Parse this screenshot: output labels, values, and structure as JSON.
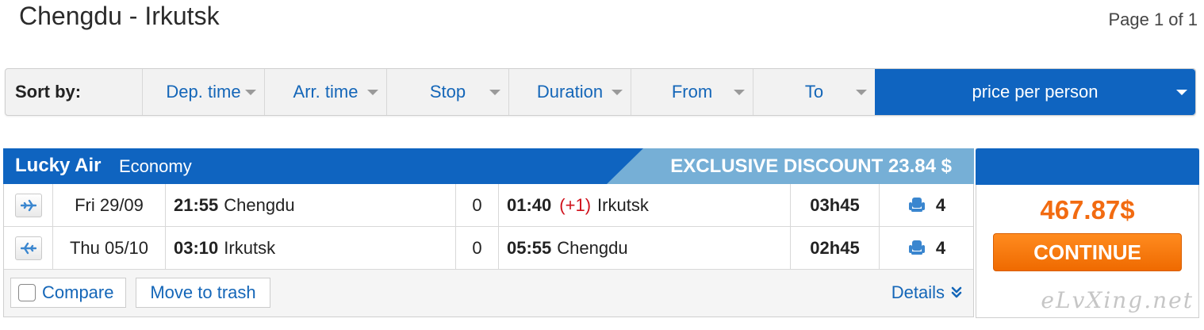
{
  "header": {
    "route_title": "Chengdu - Irkutsk",
    "page_indicator": "Page 1 of 1"
  },
  "sort_bar": {
    "label": "Sort by:",
    "options": [
      "Dep. time",
      "Arr. time",
      "Stop",
      "Duration",
      "From",
      "To",
      "price per person"
    ],
    "active_option": "price per person"
  },
  "result": {
    "airline": "Lucky Air",
    "cabin": "Economy",
    "discount_banner": "EXCLUSIVE DISCOUNT 23.84 $",
    "flights": [
      {
        "direction_icon": "plane-outbound-icon",
        "date": "Fri 29/09",
        "dep_time": "21:55",
        "dep_city": "Chengdu",
        "stops": "0",
        "arr_time": "01:40",
        "day_offset": "(+1)",
        "arr_city": "Irkutsk",
        "duration": "03h45",
        "seats": "4"
      },
      {
        "direction_icon": "plane-return-icon",
        "date": "Thu 05/10",
        "dep_time": "03:10",
        "dep_city": "Irkutsk",
        "stops": "0",
        "arr_time": "05:55",
        "day_offset": "",
        "arr_city": "Chengdu",
        "duration": "02h45",
        "seats": "4"
      }
    ],
    "compare_label": "Compare",
    "trash_label": "Move to trash",
    "details_label": "Details",
    "price": "467.87$",
    "continue_label": "CONTINUE",
    "watermark": "eLvXing.net"
  },
  "colors": {
    "brand_blue": "#0f64c0",
    "discount_blue": "#76afd6",
    "price_orange": "#f26b11",
    "link_blue": "#1466b8",
    "offset_red": "#d0111b"
  }
}
